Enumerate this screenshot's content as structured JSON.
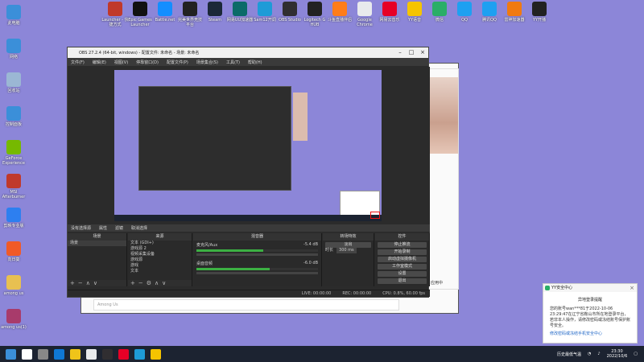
{
  "desktop_icons_left": [
    {
      "label": "此电脑",
      "icon": "computer-icon",
      "color": "#3b8fd9"
    },
    {
      "label": "网络",
      "icon": "network-icon",
      "color": "#3b8fd9"
    },
    {
      "label": "回收站",
      "icon": "recycle-bin-icon",
      "color": "#9bb7d4"
    },
    {
      "label": "控制面板",
      "icon": "control-panel-icon",
      "color": "#3b8fd9"
    },
    {
      "label": "GeForce Experience",
      "icon": "geforce-icon",
      "color": "#76b900"
    },
    {
      "label": "MSI Afterburner",
      "icon": "afterburner-icon",
      "color": "#c0392b"
    },
    {
      "label": "剪映专业版",
      "icon": "jianying-icon",
      "color": "#2d7ff0"
    },
    {
      "label": "向日葵",
      "icon": "sunflower-icon",
      "color": "#f05a28"
    },
    {
      "label": "among us",
      "icon": "folder-icon",
      "color": "#e8c051"
    },
    {
      "label": "among us(1)",
      "icon": "winrar-icon",
      "color": "#a83b6b"
    }
  ],
  "desktop_icons_top": [
    {
      "label": "Launcher - 快捷方式",
      "icon": "launcher-icon",
      "color": "#c0392b"
    },
    {
      "label": "Epic Games Launcher",
      "icon": "epic-icon",
      "color": "#111111"
    },
    {
      "label": "Battle.net",
      "icon": "battlenet-icon",
      "color": "#148eff"
    },
    {
      "label": "完美世界竞技平台",
      "icon": "perfect-world-icon",
      "color": "#222222"
    },
    {
      "label": "Steam",
      "icon": "steam-icon",
      "color": "#1b2838"
    },
    {
      "label": "网易UU加速器",
      "icon": "uu-icon",
      "color": "#0b6b68"
    },
    {
      "label": "Sam12开调",
      "icon": "sam-icon",
      "color": "#1e9bd7"
    },
    {
      "label": "OBS Studio",
      "icon": "obs-icon",
      "color": "#302e31"
    },
    {
      "label": "Logitech G HUB",
      "icon": "ghub-icon",
      "color": "#222222"
    },
    {
      "label": "斗鱼直播伴侣",
      "icon": "douyu-icon",
      "color": "#ff7d1a"
    },
    {
      "label": "Google Chrome",
      "icon": "chrome-icon",
      "color": "#e8eaed"
    },
    {
      "label": "网易云音乐",
      "icon": "netease-music-icon",
      "color": "#e60026"
    },
    {
      "label": "YY语音",
      "icon": "yy-icon",
      "color": "#f5c400"
    },
    {
      "label": "微信",
      "icon": "wechat-icon",
      "color": "#2aae67"
    },
    {
      "label": "QQ",
      "icon": "qq-icon",
      "color": "#1ea0f1"
    },
    {
      "label": "腾讯QQ",
      "icon": "tencent-qq-icon",
      "color": "#1ea0f1"
    },
    {
      "label": "雷神加速器",
      "icon": "leishen-icon",
      "color": "#f07a10"
    },
    {
      "label": "YY开播",
      "icon": "yy-live-icon",
      "color": "#222222"
    }
  ],
  "obs": {
    "title": "OBS 27.2.4 (64-bit, windows) - 配置文件: 未命名 - 场景: 未命名",
    "menu": [
      "文件(F)",
      "编辑(E)",
      "视图(V)",
      "停靠窗口(D)",
      "配置文件(P)",
      "场景集合(S)",
      "工具(T)",
      "帮助(H)"
    ],
    "source_bar": {
      "no_source": "没有选择源",
      "properties": "属性",
      "filters": "滤镜",
      "deinterlace": "取消选择"
    },
    "docks": {
      "scenes": {
        "title": "场景",
        "items": [
          "场景"
        ]
      },
      "sources": {
        "title": "来源",
        "items": [
          "文本 (GDI+)",
          "游戏源 2",
          "视频采集设备",
          "游戏源",
          "游戏",
          "文本"
        ]
      },
      "mixer": {
        "title": "混音器",
        "channels": [
          {
            "name": "麦克风/Aux",
            "db": "-5.4 dB",
            "meter": 0.55
          },
          {
            "name": "桌面音频",
            "db": "-6.0 dB",
            "meter": 0.6
          }
        ]
      },
      "transitions": {
        "title": "转场特效",
        "type": "淡出",
        "duration_label": "时长",
        "duration": "300 ms"
      },
      "controls": {
        "title": "控件",
        "buttons": [
          "停止推流",
          "开始录制",
          "启动虚拟摄像机",
          "工作室模式",
          "设置",
          "退出"
        ]
      }
    },
    "status": {
      "live": "LIVE: 00:00:00",
      "rec": "REC: 00:00:00",
      "cpu": "CPU: 0.8%, 60.00 fps"
    }
  },
  "notification": {
    "app": "YY安全中心",
    "header": "异地登录提醒",
    "body": "您的账号wan***81于2022-10-06 23:29:47在辽宁省鞍山市所在地登录平台，若非本人操作，请修改密码或冻结账号保护账号安全。",
    "link": "修改密码或冻结手机安全中心"
  },
  "taskbar": {
    "time": "23:30",
    "date": "2022/10/6",
    "weather": "历史最低气温",
    "icons": [
      "start-icon",
      "search-icon",
      "task-view-icon",
      "edge-icon",
      "explorer-icon",
      "chrome-icon",
      "obs-icon",
      "netease-music-icon",
      "game-icon",
      "yy-icon"
    ]
  },
  "bg_window": {
    "input_placeholder": "Among Us",
    "status": "应用中"
  }
}
